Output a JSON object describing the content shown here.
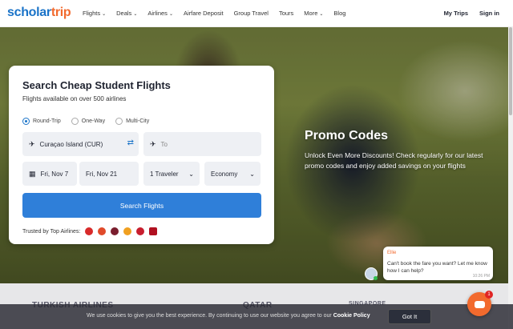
{
  "header": {
    "logo_part1": "scholar",
    "logo_part2": "trip",
    "nav": [
      {
        "label": "Flights",
        "caret": true
      },
      {
        "label": "Deals",
        "caret": true
      },
      {
        "label": "Airlines",
        "caret": true
      },
      {
        "label": "Airfare Deposit",
        "caret": false
      },
      {
        "label": "Group Travel",
        "caret": false
      },
      {
        "label": "Tours",
        "caret": false
      },
      {
        "label": "More",
        "caret": true
      },
      {
        "label": "Blog",
        "caret": false
      }
    ],
    "my_trips": "My Trips",
    "sign_in": "Sign in"
  },
  "search": {
    "title": "Search Cheap Student Flights",
    "subtitle": "Flights available on over 500 airlines",
    "trip_types": [
      "Round-Trip",
      "One-Way",
      "Multi-City"
    ],
    "selected_trip_type": "Round-Trip",
    "from_value": "Curaçao Island (CUR)",
    "to_placeholder": "To",
    "depart_date": "Fri, Nov 7",
    "return_date": "Fri, Nov 21",
    "travelers": "1 Traveler",
    "cabin_class": "Economy",
    "button_label": "Search Flights",
    "trusted_label": "Trusted by Top Airlines:"
  },
  "promo": {
    "title": "Promo Codes",
    "text": "Unlock Even More Discounts! Check regularly for our latest promo codes and enjoy added savings on your flights"
  },
  "chat": {
    "agent_name": "Ellie",
    "message": "Can't book the fare you want? Let me know how I can help?",
    "time": "10:26 PM",
    "unread_count": "1"
  },
  "airline_strip": [
    "TURKISH AIRLINES",
    "QATAR",
    "SINGAPORE"
  ],
  "cookie": {
    "text": "We use cookies to give you the best experience. By continuing to use our website you agree to our",
    "policy_link": "Cookie Policy",
    "button": "Got It"
  },
  "colors": {
    "brand_blue": "#1a73c8",
    "brand_orange": "#f26a2e",
    "button_blue": "#2f7fd9"
  }
}
